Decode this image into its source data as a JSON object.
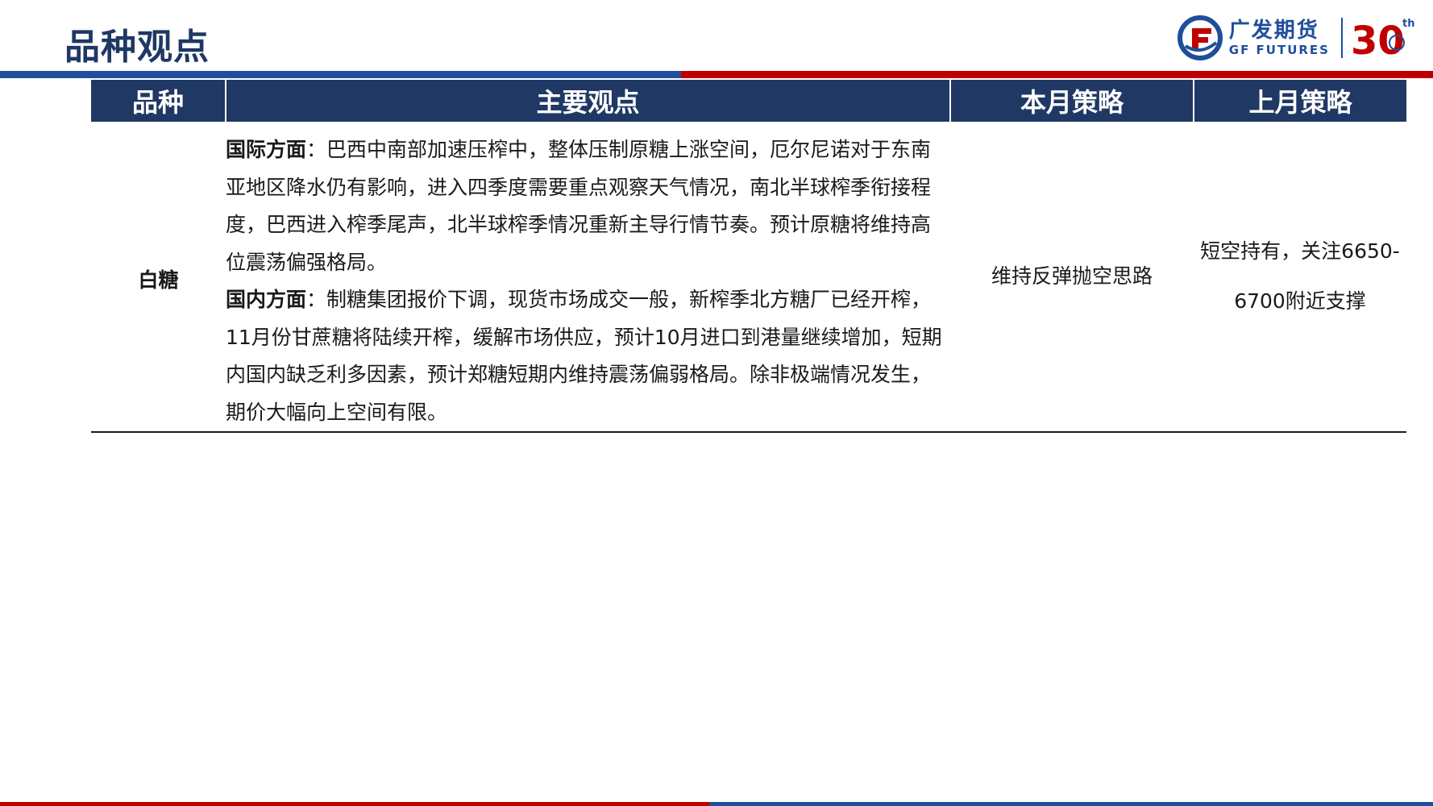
{
  "page": {
    "title": "品种观点"
  },
  "brand": {
    "name_cn": "广发期货",
    "name_en": "GF FUTURES",
    "anniversary": "30",
    "anniversary_suffix": "th",
    "colors": {
      "navy": "#1f3864",
      "blue": "#1f4e9b",
      "red": "#c00000"
    }
  },
  "table": {
    "headers": [
      "品种",
      "主要观点",
      "本月策略",
      "上月策略"
    ],
    "rows": [
      {
        "variety": "白糖",
        "international_label": "国际方面",
        "international_text": "：巴西中南部加速压榨中，整体压制原糖上涨空间，厄尔尼诺对于东南亚地区降水仍有影响，进入四季度需要重点观察天气情况，南北半球榨季衔接程度，巴西进入榨季尾声，北半球榨季情况重新主导行情节奏。预计原糖将维持高位震荡偏强格局。",
        "domestic_label": "国内方面",
        "domestic_text": "：制糖集团报价下调，现货市场成交一般，新榨季北方糖厂已经开榨，11月份甘蔗糖将陆续开榨，缓解市场供应，预计10月进口到港量继续增加，短期内国内缺乏利多因素，预计郑糖短期内维持震荡偏弱格局。除非极端情况发生，期价大幅向上空间有限。",
        "this_month": "维持反弹抛空思路",
        "last_month": "短空持有，关注6650-6700附近支撑"
      }
    ]
  }
}
